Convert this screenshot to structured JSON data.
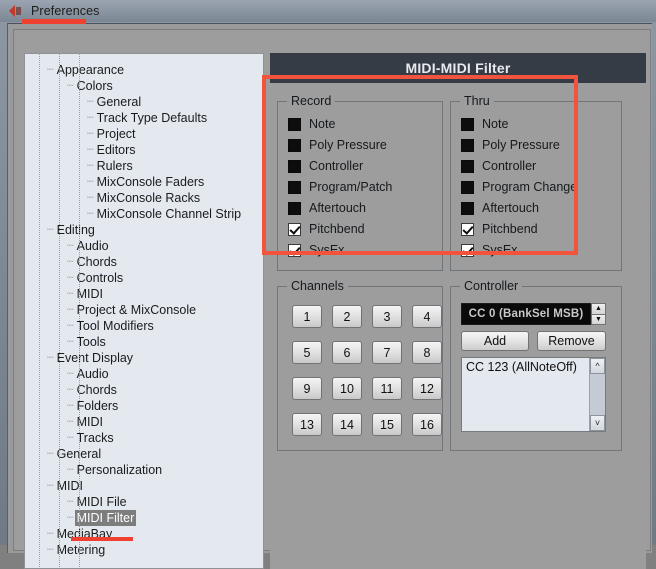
{
  "window": {
    "title": "Preferences",
    "back_icon": "back-arrow-icon"
  },
  "page": {
    "header_title": "MIDI-MIDI Filter"
  },
  "sidebar": {
    "items": [
      {
        "label": "Appearance",
        "level": 0,
        "selected": false
      },
      {
        "label": "Colors",
        "level": 1,
        "selected": false
      },
      {
        "label": "General",
        "level": 2,
        "selected": false
      },
      {
        "label": "Track Type Defaults",
        "level": 2,
        "selected": false
      },
      {
        "label": "Project",
        "level": 2,
        "selected": false
      },
      {
        "label": "Editors",
        "level": 2,
        "selected": false
      },
      {
        "label": "Rulers",
        "level": 2,
        "selected": false
      },
      {
        "label": "MixConsole Faders",
        "level": 2,
        "selected": false
      },
      {
        "label": "MixConsole Racks",
        "level": 2,
        "selected": false
      },
      {
        "label": "MixConsole Channel Strip",
        "level": 2,
        "selected": false
      },
      {
        "label": "Editing",
        "level": 0,
        "selected": false
      },
      {
        "label": "Audio",
        "level": 1,
        "selected": false
      },
      {
        "label": "Chords",
        "level": 1,
        "selected": false
      },
      {
        "label": "Controls",
        "level": 1,
        "selected": false
      },
      {
        "label": "MIDI",
        "level": 1,
        "selected": false
      },
      {
        "label": "Project & MixConsole",
        "level": 1,
        "selected": false
      },
      {
        "label": "Tool Modifiers",
        "level": 1,
        "selected": false
      },
      {
        "label": "Tools",
        "level": 1,
        "selected": false
      },
      {
        "label": "Event Display",
        "level": 0,
        "selected": false
      },
      {
        "label": "Audio",
        "level": 1,
        "selected": false
      },
      {
        "label": "Chords",
        "level": 1,
        "selected": false
      },
      {
        "label": "Folders",
        "level": 1,
        "selected": false
      },
      {
        "label": "MIDI",
        "level": 1,
        "selected": false
      },
      {
        "label": "Tracks",
        "level": 1,
        "selected": false
      },
      {
        "label": "General",
        "level": 0,
        "selected": false
      },
      {
        "label": "Personalization",
        "level": 1,
        "selected": false
      },
      {
        "label": "MIDI",
        "level": 0,
        "selected": false
      },
      {
        "label": "MIDI File",
        "level": 1,
        "selected": false
      },
      {
        "label": "MIDI Filter",
        "level": 1,
        "selected": true
      },
      {
        "label": "MediaBay",
        "level": 0,
        "selected": false
      },
      {
        "label": "Metering",
        "level": 0,
        "selected": false
      }
    ]
  },
  "record_group": {
    "title": "Record",
    "items": [
      {
        "label": "Note",
        "checked": false
      },
      {
        "label": "Poly Pressure",
        "checked": false
      },
      {
        "label": "Controller",
        "checked": false
      },
      {
        "label": "Program/Patch",
        "checked": false
      },
      {
        "label": "Aftertouch",
        "checked": false
      },
      {
        "label": "Pitchbend",
        "checked": true
      },
      {
        "label": "SysEx",
        "checked": true
      }
    ]
  },
  "thru_group": {
    "title": "Thru",
    "items": [
      {
        "label": "Note",
        "checked": false
      },
      {
        "label": "Poly Pressure",
        "checked": false
      },
      {
        "label": "Controller",
        "checked": false
      },
      {
        "label": "Program Change",
        "checked": false
      },
      {
        "label": "Aftertouch",
        "checked": false
      },
      {
        "label": "Pitchbend",
        "checked": true
      },
      {
        "label": "SysEx",
        "checked": true
      }
    ]
  },
  "channels_group": {
    "title": "Channels",
    "buttons": [
      "1",
      "2",
      "3",
      "4",
      "5",
      "6",
      "7",
      "8",
      "9",
      "10",
      "11",
      "12",
      "13",
      "14",
      "15",
      "16"
    ]
  },
  "controller_group": {
    "title": "Controller",
    "selected_value": "CC 0  (BankSel MSB)",
    "spinner_up_icon": "spinner-up-icon",
    "spinner_down_icon": "spinner-down-icon",
    "add_label": "Add",
    "remove_label": "Remove",
    "list_items": [
      "CC 123  (AllNoteOff)"
    ],
    "scroll_up_icon": "scroll-up-icon",
    "scroll_down_icon": "scroll-down-icon"
  },
  "annotations": {
    "accent_color": "#f2533c",
    "highlight_rect_name": "record-thru-highlight",
    "underline_preferences": "preferences-underline",
    "underline_midi_filter": "midi-filter-underline"
  },
  "colors": {
    "header_bg": "#353c45",
    "panel_bg": "#9d9d9d",
    "tree_bg": "#e4e9f0",
    "selection_bg": "#7d7d7d",
    "value_field_bg": "#0a0a0a"
  }
}
